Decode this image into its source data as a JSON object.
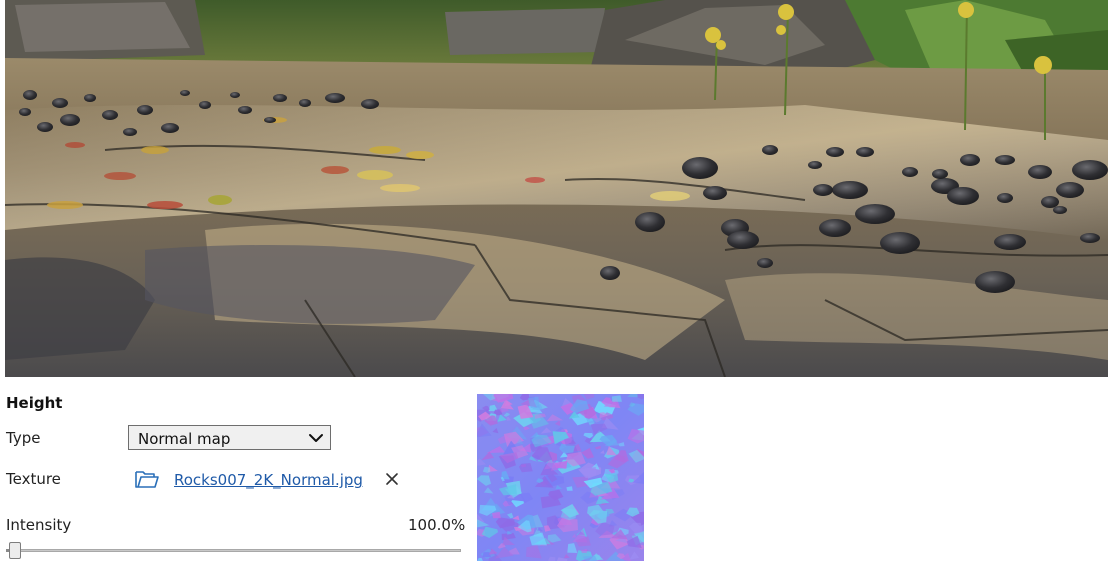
{
  "section": {
    "title": "Height"
  },
  "type_row": {
    "label": "Type",
    "selected": "Normal map",
    "icon": "chevron-down-icon"
  },
  "texture_row": {
    "label": "Texture",
    "filename": "Rocks007_2K_Normal.jpg",
    "browse_icon": "folder-icon",
    "clear_icon": "close-icon"
  },
  "intensity_row": {
    "label": "Intensity",
    "value_text": "100.0%",
    "slider_fraction": 0.0
  },
  "preview": {
    "description_icon": "render-preview",
    "normal_map_thumbnail": "normal-map-thumbnail"
  },
  "colors": {
    "link": "#1f5aa8",
    "folder": "#2a6fb8",
    "normal_map_base": "#8080ff"
  }
}
